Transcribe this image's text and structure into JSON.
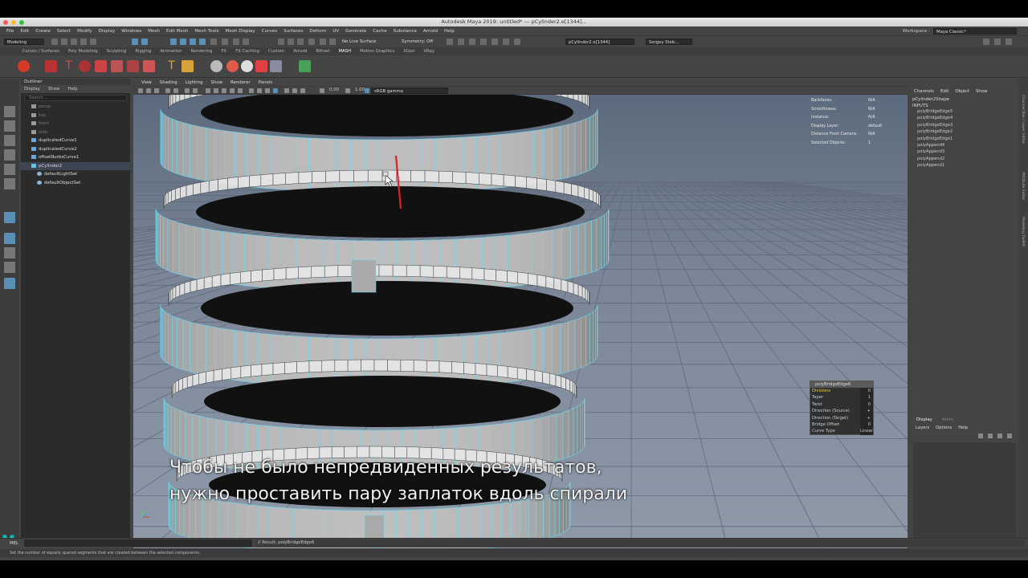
{
  "window": {
    "title": "Autodesk Maya 2019: untitled*   ---   pCylinder2.e[1344]..."
  },
  "menubar": {
    "items": [
      "File",
      "Edit",
      "Create",
      "Select",
      "Modify",
      "Display",
      "Windows",
      "Mesh",
      "Edit Mesh",
      "Mesh Tools",
      "Mesh Display",
      "Curves",
      "Surfaces",
      "Deform",
      "UV",
      "Generate",
      "Cache",
      "Substance",
      "Arnold",
      "Help"
    ],
    "workspace_label": "Workspace :",
    "workspace_value": "Maya Classic*"
  },
  "statusline": {
    "mode": "Modeling",
    "live_surface": "No Live Surface",
    "symmetry": "Symmetry: Off",
    "selection_field": "pCylinder2.e[1344]",
    "user": "Sergey Steb..."
  },
  "shelf": {
    "tabs": [
      "Curves / Surfaces",
      "Poly Modeling",
      "Sculpting",
      "Rigging",
      "Animation",
      "Rendering",
      "FX",
      "FX Caching",
      "Custom",
      "Arnold",
      "Bifrost",
      "MASH",
      "Motion Graphics",
      "XGen",
      "VRay"
    ],
    "active_tab": "MASH"
  },
  "outliner": {
    "title": "Outliner",
    "menus": [
      "Display",
      "Show",
      "Help"
    ],
    "search_placeholder": "Search...",
    "items": [
      {
        "label": "persp",
        "dim": true,
        "icon": "camera-icon"
      },
      {
        "label": "top",
        "dim": true,
        "icon": "camera-icon"
      },
      {
        "label": "front",
        "dim": true,
        "icon": "camera-icon"
      },
      {
        "label": "side",
        "dim": true,
        "icon": "camera-icon"
      },
      {
        "label": "duplicatedCurve1",
        "dim": false,
        "icon": "curve-icon"
      },
      {
        "label": "duplicatedCurve2",
        "dim": false,
        "icon": "curve-icon"
      },
      {
        "label": "offsetNurbsCurve1",
        "dim": false,
        "icon": "curve-icon"
      },
      {
        "label": "pCylinder2",
        "dim": false,
        "icon": "mesh-icon",
        "selected": true
      },
      {
        "label": "defaultLightSet",
        "dim": false,
        "icon": "set-icon"
      },
      {
        "label": "defaultObjectSet",
        "dim": false,
        "icon": "set-icon"
      }
    ]
  },
  "viewport": {
    "menus": [
      "View",
      "Shading",
      "Lighting",
      "Show",
      "Renderer",
      "Panels"
    ],
    "exposure": "0.00",
    "gamma": "1.00",
    "colorspace": "sRGB gamma",
    "camera_label": "persp",
    "hud": [
      {
        "key": "Backfaces:",
        "value": "N/A"
      },
      {
        "key": "Smoothness:",
        "value": "N/A"
      },
      {
        "key": "Instance:",
        "value": "N/A"
      },
      {
        "key": "Display Layer:",
        "value": "default"
      },
      {
        "key": "Distance From Camera:",
        "value": "N/A"
      },
      {
        "key": "Selected Objects:",
        "value": "1"
      }
    ],
    "subtitle_line1": "Чтобы не было непредвиденных результатов,",
    "subtitle_line2": "нужно проставить пару заплаток вдоль спирали"
  },
  "inview_editor": {
    "title": "polyBridgeEdge6",
    "rows": [
      {
        "key": "Divisions",
        "value": "0",
        "highlight": true
      },
      {
        "key": "Taper",
        "value": "1"
      },
      {
        "key": "Twist",
        "value": "0"
      },
      {
        "key": "Direction (Source)",
        "value": "+"
      },
      {
        "key": "Direction (Target)",
        "value": "+"
      },
      {
        "key": "Bridge Offset",
        "value": "0"
      },
      {
        "key": "Curve Type",
        "value": "Linear"
      }
    ]
  },
  "channelbox": {
    "menus": [
      "Channels",
      "Edit",
      "Object",
      "Show"
    ],
    "object": "pCylinder2Shape",
    "inputs_label": "INPUTS",
    "inputs": [
      "polyBridgeEdge5",
      "polyBridgeEdge4",
      "polyBridgeEdge3",
      "polyBridgeEdge2",
      "polyBridgeEdge1",
      "polyAppend4",
      "polyAppend3",
      "polyAppend2",
      "polyAppend1"
    ]
  },
  "layers": {
    "tabs": [
      "Display",
      "Anim"
    ],
    "menus": [
      "Layers",
      "Options",
      "Help"
    ]
  },
  "side_tabs": [
    "Channel Box / Layer Editor",
    "Attribute Editor",
    "Modeling Toolkit"
  ],
  "commandline": {
    "language": "MEL",
    "result": "// Result: polyBridgeEdge6"
  },
  "helpline": {
    "text": "Set the number of equally spaced segments that are created between the selected components."
  },
  "colors": {
    "wireframe": "#6fd8f0",
    "selected_edge": "#e02020",
    "highlight": "#e8d63a"
  }
}
